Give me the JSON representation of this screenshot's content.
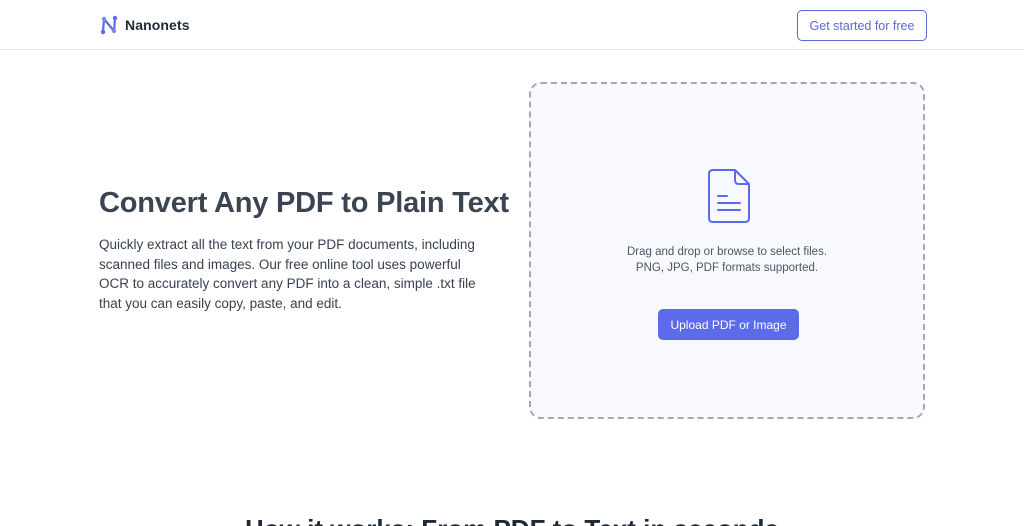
{
  "nav": {
    "brand": "Nanonets",
    "cta_label": "Get started for free"
  },
  "hero": {
    "title": "Convert Any PDF to Plain Text",
    "description": "Quickly extract all the text from your PDF documents, including scanned files and images. Our free online tool uses powerful OCR to accurately convert any PDF into a clean, simple .txt file that you can easily copy, paste, and edit."
  },
  "upload": {
    "icon": "document-icon",
    "instruction": "Drag and drop or browse to select files.",
    "formats": "PNG, JPG, PDF formats supported.",
    "button_label": "Upload PDF or Image"
  },
  "section": {
    "title": "How it works: From PDF to Text in seconds"
  },
  "colors": {
    "accent": "#5b6bea",
    "border": "#a3a8b2",
    "dropzone_bg": "#f8f9fe",
    "heading": "#3a4452"
  }
}
